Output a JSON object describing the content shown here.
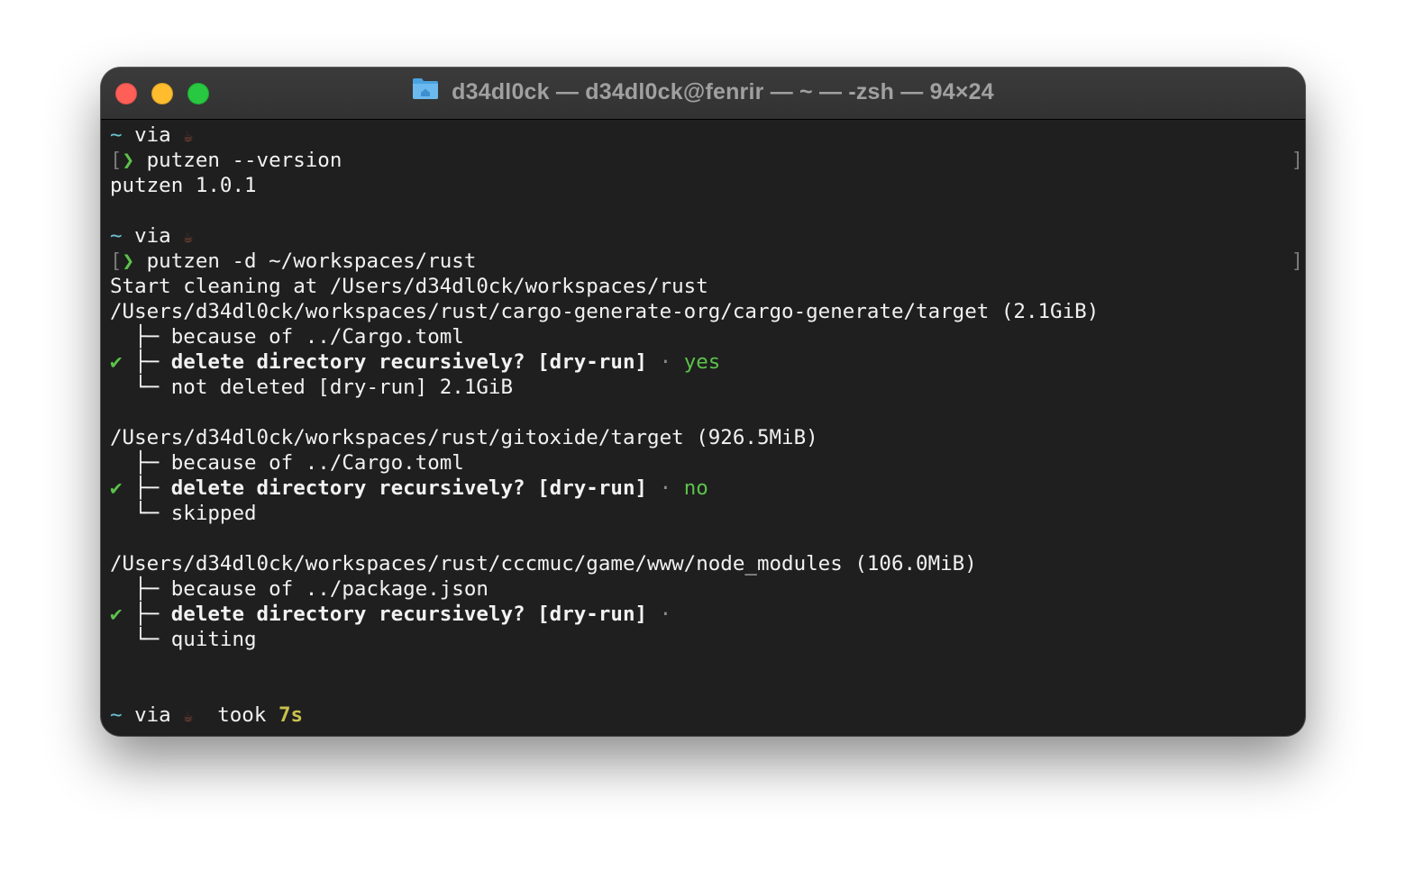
{
  "window": {
    "title": "d34dl0ck — d34dl0ck@fenrir — ~ — -zsh — 94×24",
    "title_icon": "home-folder-icon",
    "traffic_lights": {
      "close_color": "#ff5f57",
      "minimize_color": "#febc2e",
      "zoom_color": "#28c840"
    }
  },
  "terminal": {
    "prompt1": {
      "tilde": "~",
      "via": "via",
      "icon": "☕"
    },
    "cmd1": {
      "chevron": "❯",
      "text": "putzen --version"
    },
    "out_version": "putzen 1.0.1",
    "prompt2": {
      "tilde": "~",
      "via": "via",
      "icon": "☕"
    },
    "cmd2": {
      "chevron": "❯",
      "text": "putzen -d ~/workspaces/rust"
    },
    "start_line": "Start cleaning at /Users/d34dl0ck/workspaces/rust",
    "entries": [
      {
        "path": "/Users/d34dl0ck/workspaces/rust/cargo-generate-org/cargo-generate/target (2.1GiB)",
        "because": "├─ because of ../Cargo.toml",
        "check": "✔",
        "question": "├─ delete directory recursively? [dry-run]",
        "dot": "·",
        "answer": "yes",
        "result": "└─ not deleted [dry-run] 2.1GiB"
      },
      {
        "path": "/Users/d34dl0ck/workspaces/rust/gitoxide/target (926.5MiB)",
        "because": "├─ because of ../Cargo.toml",
        "check": "✔",
        "question": "├─ delete directory recursively? [dry-run]",
        "dot": "·",
        "answer": "no",
        "result": "└─ skipped"
      },
      {
        "path": "/Users/d34dl0ck/workspaces/rust/cccmuc/game/www/node_modules (106.0MiB)",
        "because": "├─ because of ../package.json",
        "check": "✔",
        "question": "├─ delete directory recursively? [dry-run]",
        "dot": "·",
        "answer": "",
        "result": "└─ quiting"
      }
    ],
    "prompt3": {
      "tilde": "~",
      "via": "via",
      "icon": "☕",
      "took": "took",
      "duration": "7s"
    },
    "colors": {
      "background": "#1f1f1f",
      "text": "#f2f2f2",
      "cyan": "#6cc4d4",
      "green": "#5bc34a",
      "yellow": "#c9c04e"
    }
  }
}
